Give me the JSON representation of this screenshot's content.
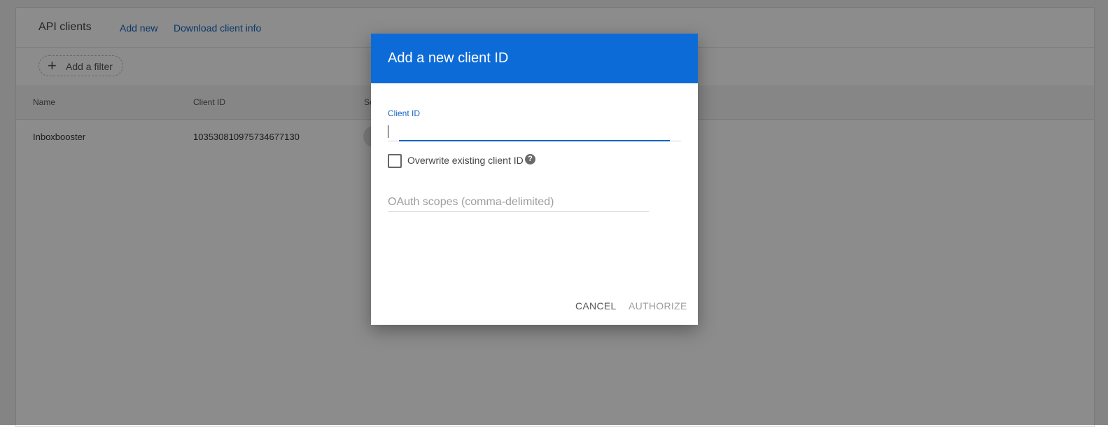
{
  "header": {
    "title": "API clients",
    "add_new": "Add new",
    "download": "Download client info"
  },
  "filter": {
    "label": "Add a filter",
    "icon": "plus-icon"
  },
  "table": {
    "columns": [
      "Name",
      "Client ID",
      "Sc"
    ],
    "rows": [
      {
        "name": "Inboxbooster",
        "client_id": "103530810975734677130"
      }
    ]
  },
  "dialog": {
    "title": "Add a new client ID",
    "client_id_label": "Client ID",
    "client_id_value": "",
    "overwrite_label": "Overwrite existing client ID",
    "help_glyph": "?",
    "scopes_placeholder": "OAuth scopes (comma-delimited)",
    "cancel": "CANCEL",
    "authorize": "AUTHORIZE"
  },
  "colors": {
    "dialog_header": "#0d6bd8",
    "link": "#1565c0",
    "scrim": "rgba(0,0,0,0.45)"
  }
}
